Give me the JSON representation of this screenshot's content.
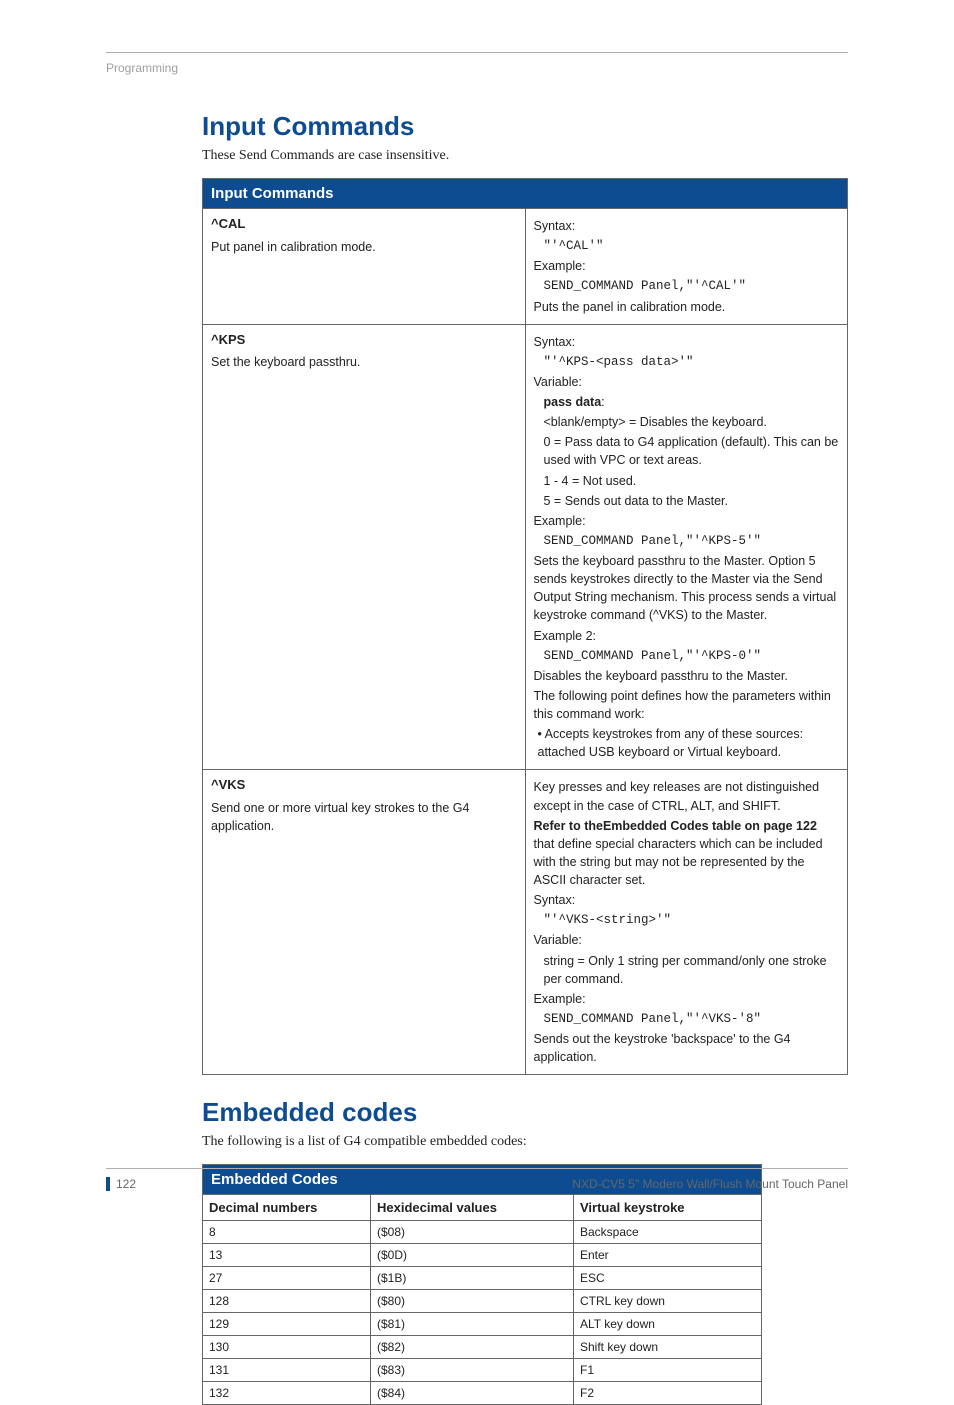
{
  "header": {
    "section": "Programming"
  },
  "section1": {
    "title": "Input Commands",
    "intro": "These Send Commands are case insensitive.",
    "table_title": "Input Commands",
    "rows": {
      "cal": {
        "name": "^CAL",
        "desc": "Put panel in calibration mode.",
        "syntax_label": "Syntax:",
        "syntax": "\"'^CAL'\"",
        "example_label": "Example:",
        "example": "SEND_COMMAND Panel,\"'^CAL'\"",
        "result": "Puts the panel in calibration mode."
      },
      "kps": {
        "name": "^KPS",
        "desc": "Set the keyboard passthru.",
        "syntax_label": "Syntax:",
        "syntax": "\"'^KPS-<pass data>'\"",
        "variable_label": "Variable:",
        "passdata_label": "pass data",
        "passdata_colon": ":",
        "v_blank": "<blank/empty> = Disables the keyboard.",
        "v_0": "0 = Pass data to G4 application (default). This can be used with VPC or text areas.",
        "v_14": "1 - 4 = Not used.",
        "v_5": "5 = Sends out data to the Master.",
        "example_label": "Example:",
        "example1": "SEND_COMMAND Panel,\"'^KPS-5'\"",
        "result1": "Sets the keyboard passthru to the Master. Option 5 sends keystrokes directly to the Master via the Send Output String mechanism. This process sends a virtual keystroke command (^VKS) to the Master.",
        "example2_label": "Example 2:",
        "example2": "SEND_COMMAND Panel,\"'^KPS-0'\"",
        "result2": "Disables the keyboard passthru to the Master.",
        "following": "The following point defines how the parameters within this command work:",
        "bullet": "• Accepts keystrokes from any of these sources: attached USB keyboard or Virtual keyboard."
      },
      "vks": {
        "name": "^VKS",
        "desc": "Send one or more virtual key strokes to the G4 application.",
        "line1": "Key presses and key releases are not distinguished except in the case of CTRL, ALT, and SHIFT.",
        "refer_bold": "Refer to theEmbedded Codes table on page 122",
        "refer_rest": " that define special characters which can be included with the string but may not be represented by the ASCII character set.",
        "syntax_label": "Syntax:",
        "syntax": "\"'^VKS-<string>'\"",
        "variable_label": "Variable:",
        "variable": "string = Only 1 string per command/only one stroke per command.",
        "example_label": "Example:",
        "example": "SEND_COMMAND Panel,\"'^VKS-'8\"",
        "result": "Sends out the keystroke 'backspace' to the G4 application."
      }
    }
  },
  "section2": {
    "title": "Embedded codes",
    "intro": "The following is a list of G4 compatible embedded codes:",
    "table_title": "Embedded Codes",
    "cols": {
      "c1": "Decimal numbers",
      "c2": "Hexidecimal values",
      "c3": "Virtual keystroke"
    }
  },
  "chart_data": {
    "type": "table",
    "columns": [
      "Decimal numbers",
      "Hexidecimal values",
      "Virtual keystroke"
    ],
    "rows": [
      [
        "8",
        "($08)",
        "Backspace"
      ],
      [
        "13",
        "($0D)",
        "Enter"
      ],
      [
        "27",
        "($1B)",
        "ESC"
      ],
      [
        "128",
        "($80)",
        "CTRL key down"
      ],
      [
        "129",
        "($81)",
        "ALT key down"
      ],
      [
        "130",
        "($82)",
        "Shift key down"
      ],
      [
        "131",
        "($83)",
        "F1"
      ],
      [
        "132",
        "($84)",
        "F2"
      ]
    ]
  },
  "footer": {
    "page": "122",
    "title": "NXD-CV5 5\" Modero Wall/Flush Mount Touch Panel"
  }
}
